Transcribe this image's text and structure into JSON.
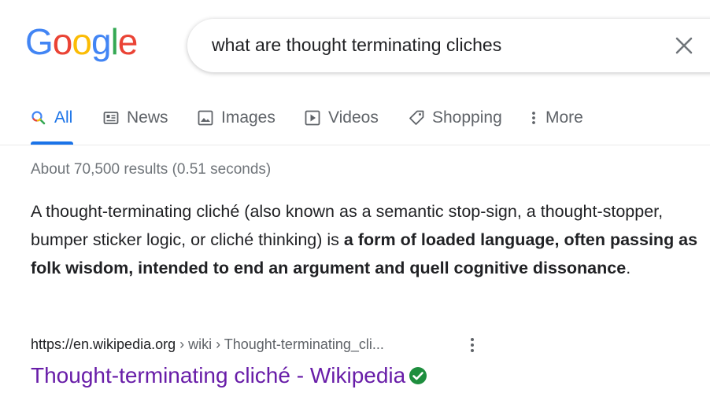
{
  "logo": {
    "letters": [
      {
        "ch": "G",
        "color": "#4285F4"
      },
      {
        "ch": "o",
        "color": "#EA4335"
      },
      {
        "ch": "o",
        "color": "#FBBC05"
      },
      {
        "ch": "g",
        "color": "#4285F4"
      },
      {
        "ch": "l",
        "color": "#34A853"
      },
      {
        "ch": "e",
        "color": "#EA4335"
      }
    ]
  },
  "search": {
    "query": "what are thought terminating cliches",
    "clear_icon": "close-icon"
  },
  "tabs": [
    {
      "label": "All",
      "icon": "search-icon",
      "active": true
    },
    {
      "label": "News",
      "icon": "news-icon",
      "active": false
    },
    {
      "label": "Images",
      "icon": "image-icon",
      "active": false
    },
    {
      "label": "Videos",
      "icon": "play-icon",
      "active": false
    },
    {
      "label": "Shopping",
      "icon": "tag-icon",
      "active": false
    },
    {
      "label": "More",
      "icon": "more-vert-icon",
      "active": false
    }
  ],
  "results_stats": "About 70,500 results (0.51 seconds)",
  "snippet": {
    "plain": "A thought-terminating cliché (also known as a semantic stop-sign, a thought-stopper, bumper sticker logic, or cliché thinking) is ",
    "bold": "a form of loaded language, often passing as folk wisdom, intended to end an argument and quell cognitive dissonance",
    "tail": "."
  },
  "result": {
    "cite_domain": "https://en.wikipedia.org",
    "cite_path": " › wiki › Thought-terminating_cli...",
    "title": "Thought-terminating cliché - Wikipedia",
    "verified_icon": "verified-check-icon",
    "menu_icon": "three-dots-icon"
  },
  "colors": {
    "accent": "#1a73e8",
    "visited_link": "#681da8",
    "verified": "#1e8e3e"
  }
}
